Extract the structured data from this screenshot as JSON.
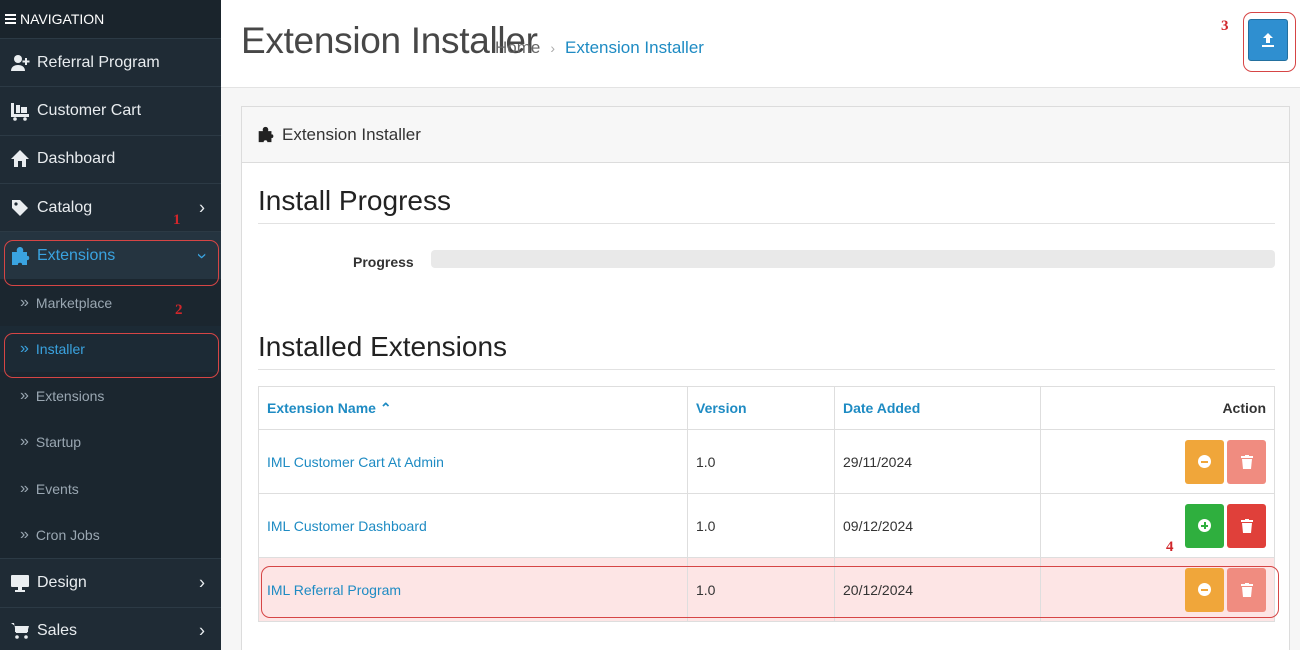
{
  "sidebar": {
    "header": "NAVIGATION",
    "items": [
      {
        "label": "Referral Program",
        "icon": "user-plus-icon"
      },
      {
        "label": "Customer Cart",
        "icon": "cart-icon"
      },
      {
        "label": "Dashboard",
        "icon": "home-icon"
      },
      {
        "label": "Catalog",
        "icon": "tag-icon"
      },
      {
        "label": "Extensions",
        "icon": "puzzle-icon"
      },
      {
        "label": "Design",
        "icon": "monitor-icon"
      },
      {
        "label": "Sales",
        "icon": "shopping-cart-icon"
      }
    ],
    "sub_items": [
      "Marketplace",
      "Installer",
      "Extensions",
      "Startup",
      "Events",
      "Cron Jobs"
    ]
  },
  "annotations": [
    "1",
    "2",
    "3",
    "4"
  ],
  "header": {
    "title": "Extension Installer",
    "breadcrumb": [
      "Home",
      "Extension Installer"
    ]
  },
  "card": {
    "title": "Extension Installer",
    "install_progress_title": "Install Progress",
    "progress_label": "Progress",
    "progress_value": 0,
    "installed_title": "Installed Extensions"
  },
  "table": {
    "headers": {
      "name": "Extension Name",
      "version": "Version",
      "date": "Date Added",
      "action": "Action"
    },
    "rows": [
      {
        "name": "IML Customer Cart At Admin",
        "version": "1.0",
        "date": "29/11/2024",
        "installed": false
      },
      {
        "name": "IML Customer Dashboard",
        "version": "1.0",
        "date": "09/12/2024",
        "installed": true
      },
      {
        "name": "IML Referral Program",
        "version": "1.0",
        "date": "20/12/2024",
        "installed": false
      }
    ]
  },
  "colors": {
    "sidebar_bg": "#1f2b35",
    "accent": "#1e8bc3",
    "primary_button": "#2f8fd0",
    "install_orange": "#f0a63a",
    "install_green": "#2faf3e",
    "uninstall_red": "#e0403a",
    "annotation_red": "#d0262b"
  }
}
